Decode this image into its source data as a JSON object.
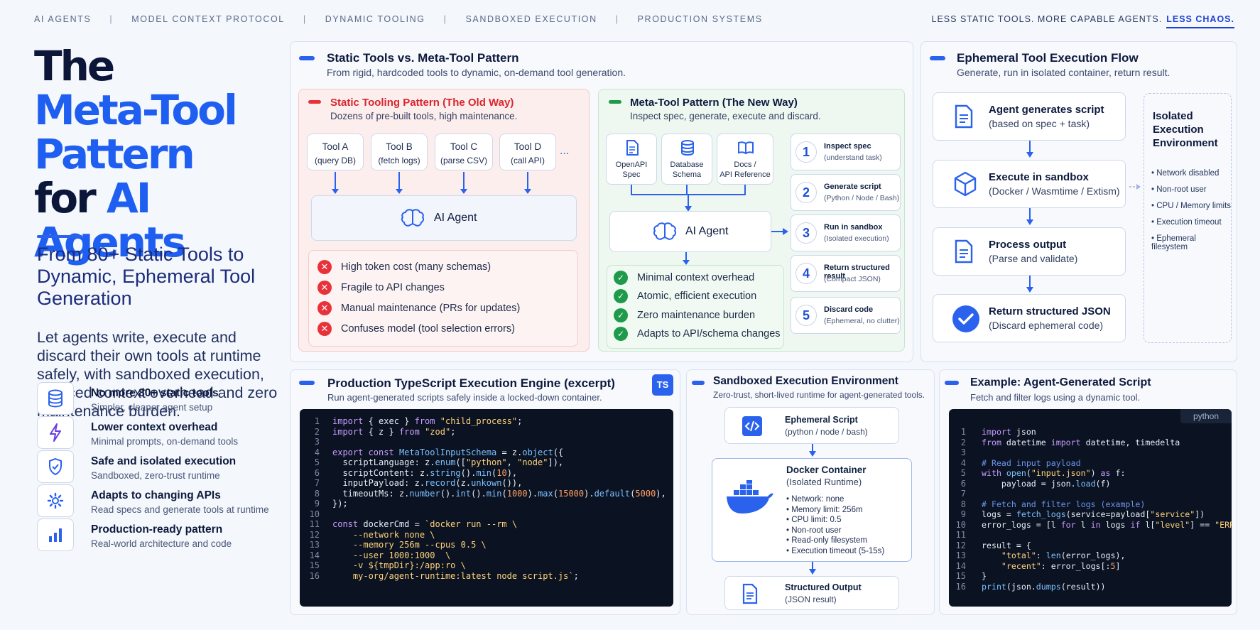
{
  "nav": {
    "items": [
      "AI AGENTS",
      "MODEL CONTEXT PROTOCOL",
      "DYNAMIC TOOLING",
      "SANDBOXED EXECUTION",
      "PRODUCTION SYSTEMS"
    ],
    "separator": "|"
  },
  "tagline": {
    "text": "LESS STATIC TOOLS. MORE CAPABLE AGENTS.",
    "emphasis": "LESS CHAOS."
  },
  "hero": {
    "title_line1": "The",
    "title_line2": "Meta-Tool",
    "title_line3": "Pattern",
    "title_line4a": "for",
    "title_line4b": "AI Agents",
    "subtitle": "From 80+ Static Tools to Dynamic, Ephemeral Tool Generation",
    "lede": "Let agents write, execute and discard their own tools at runtime safely, with sandboxed execution, reduced context overhead and zero maintenance burden."
  },
  "features": [
    {
      "icon": "database-icon",
      "title": "No more 80+ static tools",
      "desc": "Simpler, cleaner agent setup"
    },
    {
      "icon": "lightning-icon",
      "title": "Lower context overhead",
      "desc": "Minimal prompts, on-demand tools"
    },
    {
      "icon": "shield-check-icon",
      "title": "Safe and isolated execution",
      "desc": "Sandboxed, zero-trust runtime"
    },
    {
      "icon": "gear-icon",
      "title": "Adapts to changing APIs",
      "desc": "Read specs and generate tools at runtime"
    },
    {
      "icon": "bar-chart-icon",
      "title": "Production-ready pattern",
      "desc": "Real-world architecture and code"
    }
  ],
  "compare": {
    "title": "Static Tools vs. Meta-Tool Pattern",
    "subtitle": "From rigid, hardcoded tools to dynamic, on-demand tool generation.",
    "old": {
      "title": "Static Tooling Pattern (The Old Way)",
      "subtitle": "Dozens of pre-built tools, high maintenance.",
      "tools": [
        {
          "name": "Tool A",
          "desc": "(query DB)"
        },
        {
          "name": "Tool B",
          "desc": "(fetch logs)"
        },
        {
          "name": "Tool C",
          "desc": "(parse CSV)"
        },
        {
          "name": "Tool D",
          "desc": "(call API)"
        }
      ],
      "ellipsis": "...",
      "agent": "AI Agent",
      "cons": [
        "High token cost (many schemas)",
        "Fragile to API changes",
        "Manual maintenance (PRs for updates)",
        "Confuses model (tool selection errors)"
      ]
    },
    "new": {
      "title": "Meta-Tool Pattern (The New Way)",
      "subtitle": "Inspect spec, generate, execute and discard.",
      "sources": [
        {
          "l1": "OpenAPI",
          "l2": "Spec"
        },
        {
          "l1": "Database",
          "l2": "Schema"
        },
        {
          "l1": "Docs /",
          "l2": "API Reference"
        }
      ],
      "agent": "AI Agent",
      "pros": [
        "Minimal context overhead",
        "Atomic, efficient execution",
        "Zero maintenance burden",
        "Adapts to API/schema changes"
      ],
      "steps": [
        {
          "n": "1",
          "title": "Inspect spec",
          "desc": "(understand task)"
        },
        {
          "n": "2",
          "title": "Generate script",
          "desc": "(Python / Node / Bash)"
        },
        {
          "n": "3",
          "title": "Run in sandbox",
          "desc": "(Isolated execution)"
        },
        {
          "n": "4",
          "title": "Return structured result",
          "desc": "(Compact JSON)"
        },
        {
          "n": "5",
          "title": "Discard code",
          "desc": "(Ephemeral, no clutter)"
        }
      ]
    }
  },
  "flow": {
    "title": "Ephemeral Tool Execution Flow",
    "subtitle": "Generate, run in isolated container, return result.",
    "steps": [
      {
        "title": "Agent generates script",
        "desc": "(based on spec + task)"
      },
      {
        "title": "Execute in sandbox",
        "desc": "(Docker / Wasmtime / Extism)"
      },
      {
        "title": "Process output",
        "desc": "(Parse and validate)"
      },
      {
        "title": "Return structured JSON",
        "desc": "(Discard ephemeral code)"
      }
    ],
    "isolated": {
      "title": "Isolated Execution Environment",
      "items": [
        "Network disabled",
        "Non-root user",
        "CPU / Memory limits",
        "Execution timeout",
        "Ephemeral filesystem"
      ]
    }
  },
  "engine": {
    "title": "Production TypeScript Execution Engine (excerpt)",
    "subtitle": "Run agent-generated scripts safely inside a locked-down container.",
    "badge": "TS"
  },
  "sandbox": {
    "title": "Sandboxed Execution Environment",
    "subtitle": "Zero-trust, short-lived runtime for agent-generated tools.",
    "script": {
      "title": "Ephemeral Script",
      "desc": "(python / node / bash)"
    },
    "container": {
      "title": "Docker Container",
      "desc": "(Isolated Runtime)",
      "items": [
        "Network: none",
        "Memory limit: 256m",
        "CPU limit: 0.5",
        "Non-root user",
        "Read-only filesystem",
        "Execution timeout (5-15s)"
      ]
    },
    "output": {
      "title": "Structured Output",
      "desc": "(JSON result)"
    }
  },
  "example": {
    "title": "Example: Agent-Generated Script",
    "subtitle": "Fetch and filter logs using a dynamic tool.",
    "lang": "python"
  }
}
